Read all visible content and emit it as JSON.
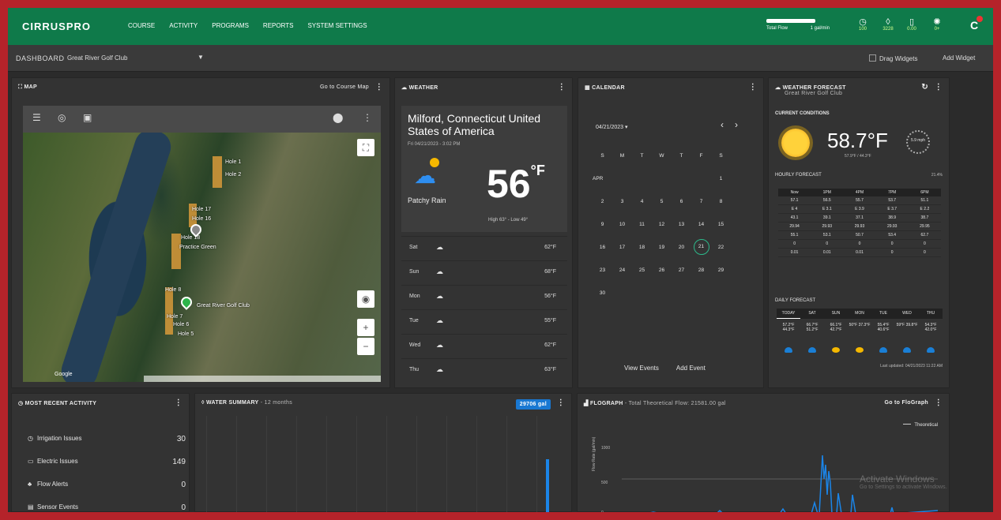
{
  "app": {
    "logo": "CIRRUSPRO",
    "nav": [
      "COURSE",
      "ACTIVITY",
      "PROGRAMS",
      "REPORTS",
      "SYSTEM SETTINGS"
    ]
  },
  "status": {
    "flow_labels": [
      "Total Flow",
      "1 gal/min"
    ],
    "stats": [
      {
        "icon": "clock-icon",
        "value": "100"
      },
      {
        "icon": "drop-icon",
        "value": "3228"
      },
      {
        "icon": "battery-icon",
        "value": "0.00"
      },
      {
        "icon": "gear-icon",
        "value": "0+"
      }
    ]
  },
  "subbar": {
    "dashboard": "DASHBOARD",
    "club": "Great River Golf Club",
    "drag": "Drag Widgets",
    "add": "Add Widget"
  },
  "map": {
    "title": "MAP",
    "goto": "Go to Course Map",
    "google": "Google",
    "labels": [
      "Hole 1",
      "Hole 2",
      "Hole 17",
      "Hole 16",
      "Hole 18",
      "Practice Green",
      "Hole 8",
      "Great River Golf Club",
      "Hole 7",
      "Hole 6",
      "Hole 5"
    ]
  },
  "weather": {
    "title": "WEATHER",
    "city": "Milford, Connecticut United States of America",
    "date": "Fri 04/21/2023 - 3:02 PM",
    "temp": "56",
    "unit": "°F",
    "condition": "Patchy Rain",
    "hilo": "High 63° - Low 49°",
    "days": [
      {
        "day": "Sat",
        "temp": "62°F"
      },
      {
        "day": "Sun",
        "temp": "68°F"
      },
      {
        "day": "Mon",
        "temp": "56°F"
      },
      {
        "day": "Tue",
        "temp": "55°F"
      },
      {
        "day": "Wed",
        "temp": "62°F"
      },
      {
        "day": "Thu",
        "temp": "63°F"
      }
    ]
  },
  "calendar": {
    "title": "CALENDAR",
    "month": "04/21/2023 ▾",
    "month_label": "APR",
    "weekdays": [
      "S",
      "M",
      "T",
      "W",
      "T",
      "F",
      "S"
    ],
    "days": [
      "",
      "",
      "",
      "",
      "",
      "",
      "1",
      "2",
      "3",
      "4",
      "5",
      "6",
      "7",
      "8",
      "9",
      "10",
      "11",
      "12",
      "13",
      "14",
      "15",
      "16",
      "17",
      "18",
      "19",
      "20",
      "21",
      "22",
      "23",
      "24",
      "25",
      "26",
      "27",
      "28",
      "29",
      "30"
    ],
    "view": "View Events",
    "add": "Add Event"
  },
  "forecast": {
    "title": "WEATHER FORECAST",
    "sub": "Great River Golf Club",
    "current": "CURRENT CONDITIONS",
    "temp": "58.7°F",
    "feels": "57.9°F / 44.3°F",
    "wind": "5.9 mph",
    "hourly": "HOURLY FORECAST",
    "hourly_right": "21.4%",
    "hours": [
      "Now",
      "1PM",
      "4PM",
      "7PM",
      "6PM"
    ],
    "rows": [
      [
        "57.1",
        "56.5",
        "55.7",
        "53.7",
        "51.1"
      ],
      [
        "E 4",
        "E 3.1",
        "E 3.9",
        "E 3.7",
        "E 2.2"
      ],
      [
        "43.1",
        "39.1",
        "37.1",
        "38.9",
        "38.7"
      ],
      [
        "29.94",
        "29.93",
        "29.93",
        "29.93",
        "29.95"
      ],
      [
        "55.1",
        "53.1",
        "50.7",
        "53.4",
        "62.7"
      ],
      [
        "0",
        "0",
        "0",
        "0",
        "0"
      ],
      [
        "0.01",
        "0.01",
        "0.01",
        "0",
        "0"
      ]
    ],
    "daily": "DAILY FORECAST",
    "day_names": [
      "TODAY",
      "SAT",
      "SUN",
      "MON",
      "TUE",
      "WED",
      "THU"
    ],
    "day_temps": [
      "57.2°F 44.3°F",
      "66.7°F 51.2°F",
      "66.1°F 42.7°F",
      "50°F 37.3°F",
      "55.4°F 40.6°F",
      "59°F 39.8°F",
      "54.3°F 42.0°F"
    ],
    "updated": "Last updated: 04/21/2023 11:22 AM",
    "colors": {
      "rain": "#1a7fd6",
      "sun": "#f5b800"
    },
    "day_icon_types": [
      "rain",
      "rain",
      "sun",
      "sun",
      "rain",
      "rain",
      "rain"
    ]
  },
  "activity": {
    "title": "MOST RECENT ACTIVITY",
    "items": [
      {
        "label": "Irrigation Issues",
        "value": "30"
      },
      {
        "label": "Electric Issues",
        "value": "149"
      },
      {
        "label": "Flow Alerts",
        "value": "0"
      },
      {
        "label": "Sensor Events",
        "value": "0"
      }
    ]
  },
  "water": {
    "title": "WATER SUMMARY",
    "sub": " - 12 months",
    "badge": "29706 gal",
    "last_month_level": 0.58
  },
  "flograph": {
    "title": "FLOGRAPH",
    "sub": " - Total Theoretical Flow: 21581.00 gal",
    "link": "Go to FloGraph",
    "legend": "Theoretical",
    "ylabel": "Flow Rate (gal/min)",
    "chart_data": {
      "type": "line",
      "series": [
        {
          "name": "Theoretical"
        }
      ],
      "ylabel": "Flow Rate (gal/min)",
      "y_ticks": [
        "1000",
        "500",
        "0"
      ]
    }
  },
  "watermark": {
    "title": "Activate Windows",
    "sub": "Go to Settings to activate Windows."
  }
}
